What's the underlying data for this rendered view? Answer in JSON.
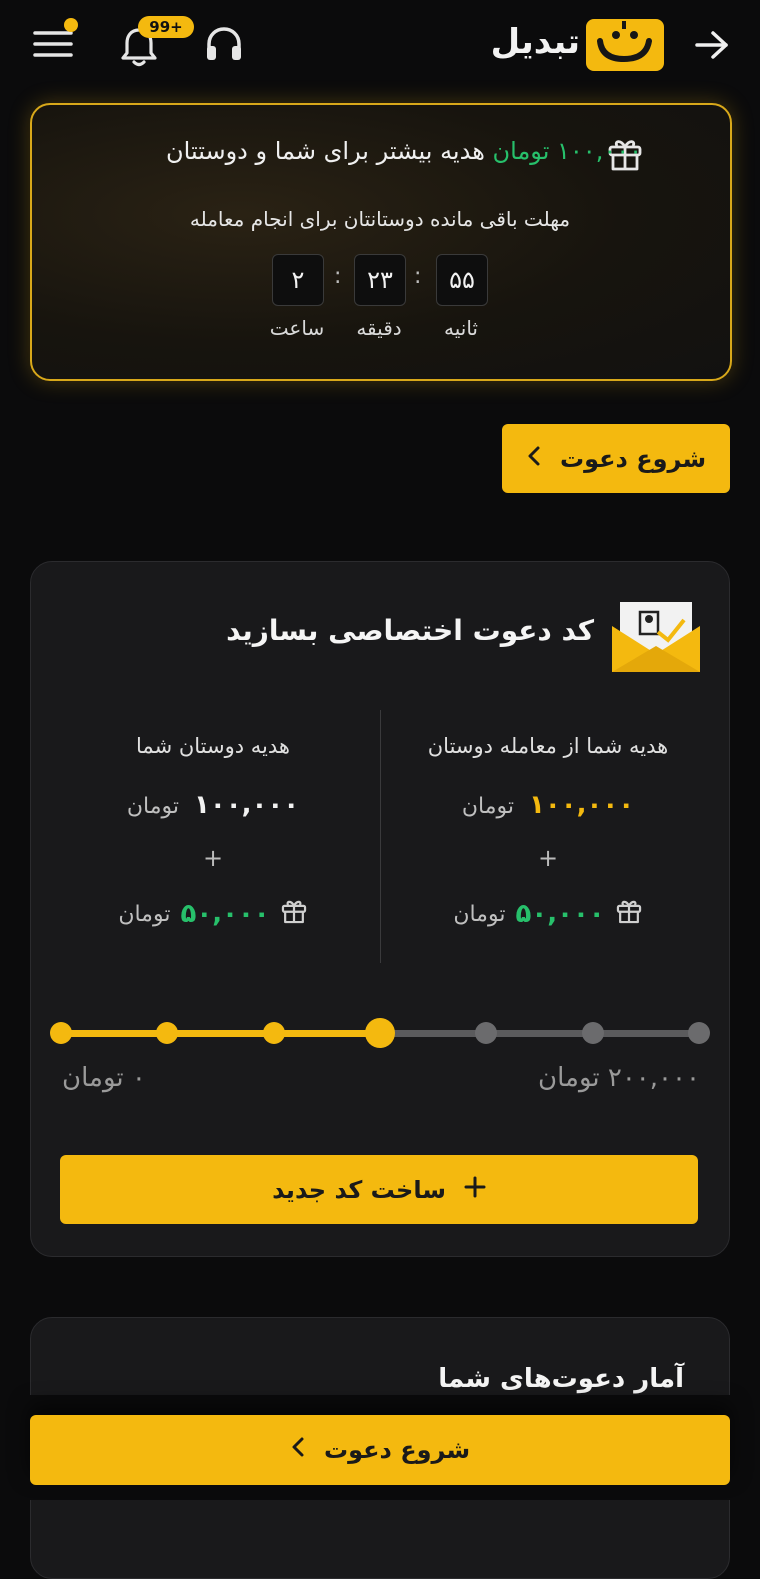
{
  "header": {
    "brand": "تبدیل",
    "notification_count": "99+"
  },
  "promo": {
    "amount": "۱۰۰,۰۰۰ تومان",
    "title_rest": "هدیه بیشتر برای شما و دوستتان",
    "subtitle": "مهلت باقی مانده دوستانتان برای انجام معامله",
    "timer": {
      "seconds": "۵۵",
      "minutes": "۲۳",
      "hours": "۲",
      "separator": ":",
      "seconds_label": "ثانیه",
      "minutes_label": "دقیقه",
      "hours_label": "ساعت"
    }
  },
  "invite_button": {
    "label": "شروع دعوت"
  },
  "code_card": {
    "title": "کد دعوت اختصاصی بسازید",
    "right_col": {
      "label": "هدیه شما از معامله دوستان",
      "amount": "۱۰۰,۰۰۰",
      "unit": "تومان",
      "plus": "+",
      "gift_amount": "۵۰,۰۰۰",
      "gift_unit": "تومان"
    },
    "left_col": {
      "label": "هدیه دوستان شما",
      "amount": "۱۰۰,۰۰۰",
      "unit": "تومان",
      "plus": "+",
      "gift_amount": "۵۰,۰۰۰",
      "gift_unit": "تومان"
    },
    "slider": {
      "min_label": "۰ تومان",
      "max_label": "۲۰۰,۰۰۰ تومان",
      "steps": 7,
      "selected_step_from_left": 4
    },
    "create_button": {
      "label": "ساخت کد جدید",
      "icon": "plus-icon"
    }
  },
  "stats_card": {
    "title": "آمار دعوت‌های شما"
  },
  "sticky_button": {
    "label": "شروع دعوت"
  },
  "colors": {
    "accent": "#f4b90f",
    "green": "#27c06b",
    "background": "#0b0b0c",
    "card": "#19191b"
  }
}
